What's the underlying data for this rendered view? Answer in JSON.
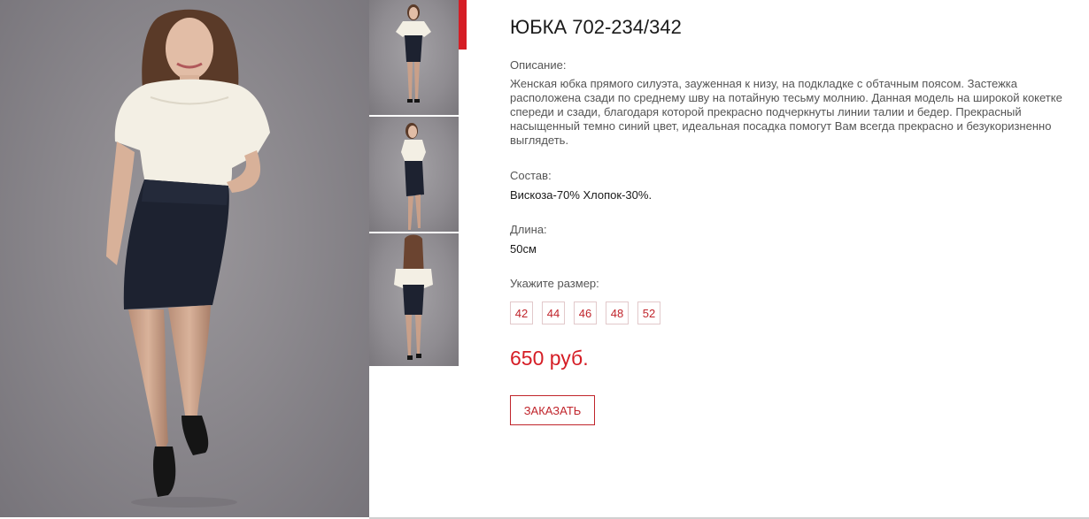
{
  "product": {
    "title": "ЮБКА 702-234/342",
    "description_label": "Описание:",
    "description": "Женская юбка прямого силуэта, зауженная к низу, на подкладке с обтачным поясом. Застежка расположена сзади по среднему шву на потайную тесьму молнию. Данная модель на широкой кокетке спереди и сзади, благодаря которой прекрасно подчеркнуты линии талии и бедер. Прекрасный насыщенный темно синий цвет, идеальная посадка помогут Вам всегда прекрасно и безукоризненно выглядеть.",
    "composition_label": "Состав:",
    "composition": "Вискоза-70% Хлопок-30%.",
    "length_label": "Длина:",
    "length": "50см",
    "size_label": "Укажите размер:",
    "sizes": [
      "42",
      "44",
      "46",
      "48",
      "52"
    ],
    "price": "650 руб.",
    "order_button": "ЗАКАЗАТЬ"
  },
  "gallery": {
    "thumbnails": [
      "front-view",
      "side-view",
      "back-view"
    ],
    "active_thumbnail": 0
  },
  "colors": {
    "accent": "#d51d25",
    "skirt": "#1d2230",
    "blouse": "#f3efe4",
    "background": "#8e8b90"
  }
}
